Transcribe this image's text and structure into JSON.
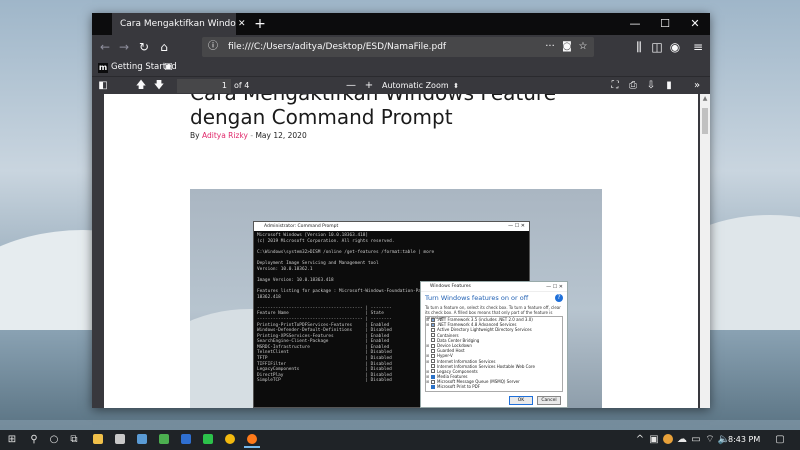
{
  "browser": {
    "tab_title": "Cara Mengaktifkan Windows Feature",
    "tab_close": "✕",
    "new_tab": "+",
    "window_controls": {
      "minimize": "—",
      "maximize": "☐",
      "close": "✕"
    },
    "url": "file:///C:/Users/aditya/Desktop/ESD/NamaFile.pdf",
    "url_more": "···",
    "bookmark_label": "Getting Started"
  },
  "pdf_toolbar": {
    "page_current": "1",
    "page_count": "of 4",
    "zoom_minus": "—",
    "zoom_plus": "+",
    "zoom_label": "Automatic Zoom",
    "zoom_chevron": "⬍",
    "more": "»"
  },
  "article": {
    "title": "Cara Mengaktifkan Windows Feature dengan Command Prompt",
    "by": "By",
    "author": "Aditya Rizky",
    "separator": "-",
    "date": "May 12, 2020"
  },
  "cmd_window": {
    "title": "Administrator: Command Prompt",
    "controls": "—  ☐  ✕",
    "lines": [
      "Microsoft Windows [Version 10.0.18363.418]",
      "(c) 2019 Microsoft Corporation. All rights reserved.",
      "",
      "C:\\Windows\\system32>DISM /online /get-features /format:table | more",
      "",
      "Deployment Image Servicing and Management tool",
      "Version: 10.0.18362.1",
      "",
      "Image Version: 10.0.18363.418",
      "",
      "Features listing for package : Microsoft-Windows-Foundation-Package~31bf3856ad364e35~amd64~~10.0.",
      "18362.418",
      "",
      "---------------------------------------- | --------",
      "Feature Name                             | State",
      "---------------------------------------- | --------",
      "Printing-PrintToPDFServices-Features     | Enabled",
      "Windows-Defender-Default-Definitions     | Disabled",
      "Printing-XPSServices-Features            | Enabled",
      "SearchEngine-Client-Package              | Enabled",
      "MSRDC-Infrastructure                     | Enabled",
      "TelnetClient                             | Disabled",
      "TFTP                                     | Disabled",
      "TIFFIFilter                              | Disabled",
      "LegacyComponents                         | Disabled",
      "DirectPlay                               | Disabled",
      "SimpleTCP                                | Disabled"
    ]
  },
  "features_window": {
    "title": "Windows Features",
    "controls": "—  ☐  ✕",
    "heading": "Turn Windows features on or off",
    "help": "?",
    "description": "To turn a feature on, select its check box. To turn a feature off, clear its check box. A filled box means that only part of the feature is turned on.",
    "items": [
      {
        "label": ".NET Framework 3.5 (includes .NET 2.0 and 3.0)",
        "state": "part",
        "expand": "⊞"
      },
      {
        "label": ".NET Framework 4.8 Advanced Services",
        "state": "part",
        "expand": "⊞"
      },
      {
        "label": "Active Directory Lightweight Directory Services",
        "state": "off",
        "expand": ""
      },
      {
        "label": "Containers",
        "state": "off",
        "expand": ""
      },
      {
        "label": "Data Center Bridging",
        "state": "off",
        "expand": ""
      },
      {
        "label": "Device Lockdown",
        "state": "off",
        "expand": "⊞"
      },
      {
        "label": "Guarded Host",
        "state": "off",
        "expand": ""
      },
      {
        "label": "Hyper-V",
        "state": "off",
        "expand": "⊞"
      },
      {
        "label": "Internet Information Services",
        "state": "off",
        "expand": "⊞"
      },
      {
        "label": "Internet Information Services Hostable Web Core",
        "state": "off",
        "expand": ""
      },
      {
        "label": "Legacy Components",
        "state": "off",
        "expand": "⊞"
      },
      {
        "label": "Media Features",
        "state": "on",
        "expand": "⊞"
      },
      {
        "label": "Microsoft Message Queue (MSMQ) Server",
        "state": "off",
        "expand": "⊞"
      },
      {
        "label": "Microsoft Print to PDF",
        "state": "on",
        "expand": ""
      }
    ],
    "ok_label": "OK",
    "cancel_label": "Cancel"
  },
  "taskbar": {
    "time": "8:43 PM"
  },
  "colors": {
    "firefox_dark": "#38383d",
    "author_pink": "#e0286a",
    "dialog_heading_blue": "#1e5fb3",
    "taskbar": "#1f2327"
  }
}
